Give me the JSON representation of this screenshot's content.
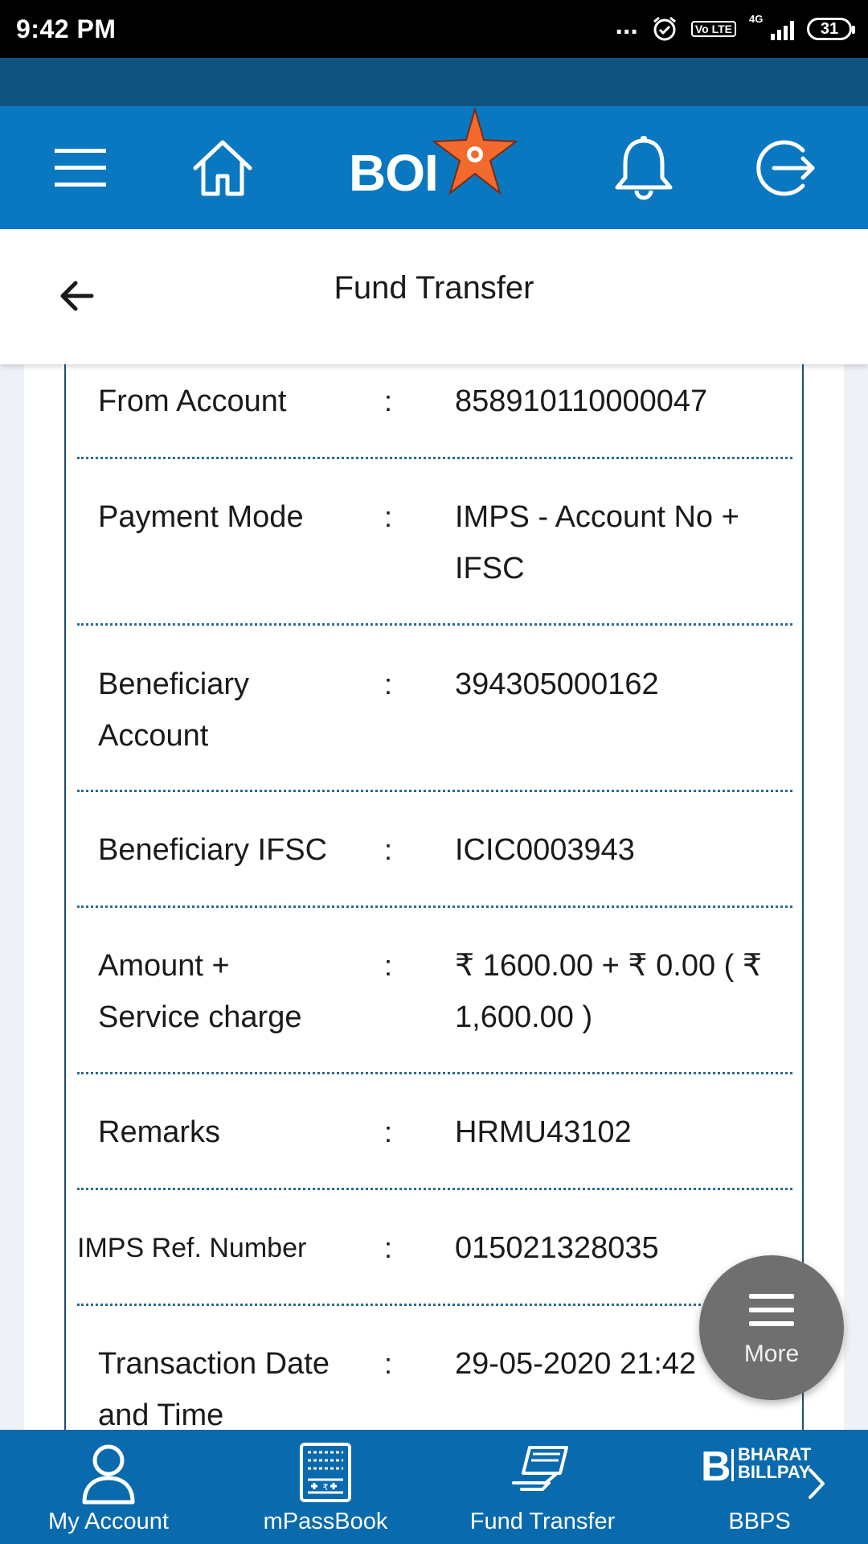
{
  "status_bar": {
    "time": "9:42 PM",
    "dots": "...",
    "volte": "Vo LTE",
    "network": "4G",
    "battery": "31"
  },
  "header": {
    "logo_text": "BOI"
  },
  "page": {
    "title": "Fund Transfer"
  },
  "details": {
    "separator": ":",
    "rows": [
      {
        "label": "From Account",
        "value": "858910110000047"
      },
      {
        "label": "Payment Mode",
        "value": "IMPS - Account No + IFSC"
      },
      {
        "label": "Beneficiary Account",
        "value": "394305000162"
      },
      {
        "label": "Beneficiary IFSC",
        "value": "ICIC0003943"
      },
      {
        "label": "Amount + Service charge",
        "value": "₹ 1600.00 + ₹ 0.00 ( ₹ 1,600.00 )"
      },
      {
        "label": "Remarks",
        "value": "HRMU43102"
      },
      {
        "label": "IMPS Ref. Number",
        "value": "015021328035"
      },
      {
        "label": "Transaction Date and Time",
        "value": "29-05-2020 21:42"
      }
    ]
  },
  "fab": {
    "label": "More"
  },
  "bottom_nav": {
    "items": [
      {
        "label": "My Account",
        "icon": "person-icon"
      },
      {
        "label": "mPassBook",
        "icon": "passbook-icon"
      },
      {
        "label": "Fund Transfer",
        "icon": "fund-transfer-icon"
      },
      {
        "label": "BBPS",
        "icon": "bharat-billpay-icon"
      }
    ],
    "bbps_logo_line1": "BHARAT",
    "bbps_logo_line2": "BILLPAY"
  },
  "colors": {
    "header_blue": "#0a78c1",
    "strip_dark": "#0f5480",
    "nav_blue": "#0a6aae",
    "star_orange": "#f26a2e",
    "divider": "#2b6a96"
  }
}
